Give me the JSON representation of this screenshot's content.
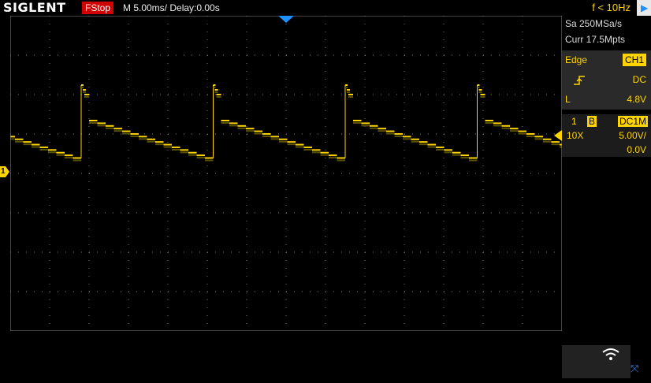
{
  "topbar": {
    "brand": "SIGLENT",
    "run_state": "FStop",
    "timebase": "M 5.00ms/ Delay:0.00s",
    "frequency": "f < 10Hz"
  },
  "acquisition": {
    "sample_rate": "Sa 250MSa/s",
    "memory": "Curr 17.5Mpts"
  },
  "trigger": {
    "type": "Edge",
    "source": "CH1",
    "slope_icon": "rising-edge-icon",
    "coupling": "DC",
    "level_label": "L",
    "level": "4.8V"
  },
  "channel1": {
    "number": "1",
    "bw_limit": "B",
    "coupling": "DC1M",
    "probe": "10X",
    "scale": "5.00V/",
    "offset": "0.0V",
    "color": "#ffd400"
  },
  "markers": {
    "ground_label": "1"
  },
  "colors": {
    "trace": "#ffd400",
    "stop_badge": "#d00000",
    "trigger_marker": "#1e90ff",
    "grid": "#7a7a7a"
  },
  "waveform": {
    "shape": "sawtooth",
    "period_divisions": 3.35,
    "phase_divisions": 1.8,
    "peak_divisions_above_ground": 2.2,
    "step_top_divisions_above_ground": 1.3,
    "trough_divisions_above_ground": 0.35
  }
}
